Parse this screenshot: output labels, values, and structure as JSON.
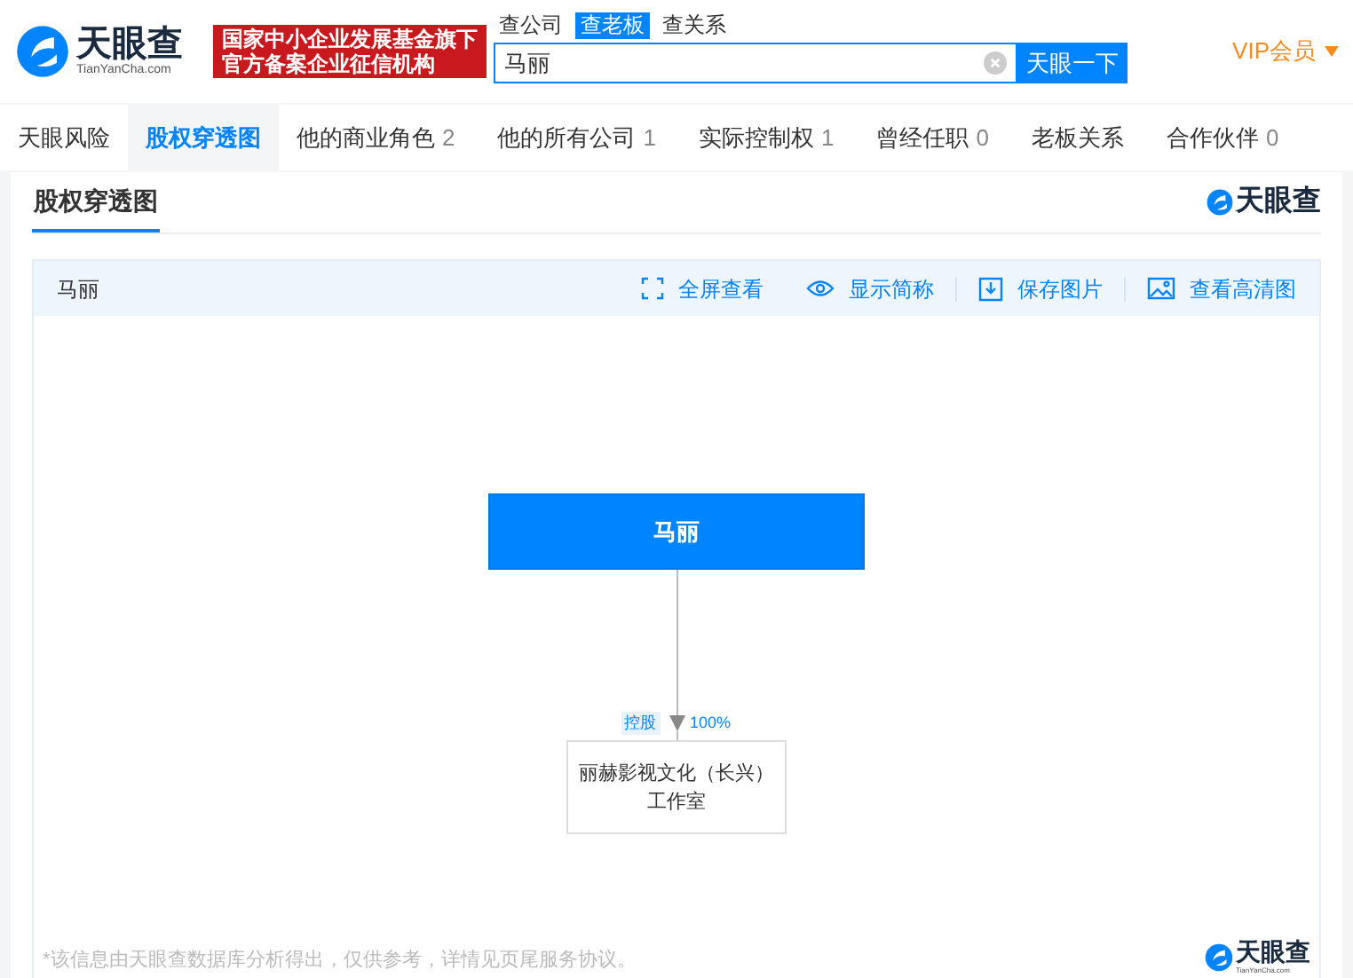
{
  "header": {
    "logo_text": "天眼查",
    "logo_subtext": "TianYanCha.com",
    "banner_lines": [
      "国家中小企业发展基金旗下",
      "官方备案企业征信机构"
    ],
    "search_tabs": [
      {
        "label": "查公司",
        "selected": false
      },
      {
        "label": "查老板",
        "selected": true
      },
      {
        "label": "查关系",
        "selected": false
      }
    ],
    "search": {
      "value": "马丽",
      "button": "天眼一下"
    },
    "vip": "VIP会员"
  },
  "tabs": [
    {
      "label": "天眼风险",
      "selected": false
    },
    {
      "label": "股权穿透图",
      "selected": true
    },
    {
      "label": "他的商业角色",
      "count": "2",
      "selected": false
    },
    {
      "label": "他的所有公司",
      "count": "1",
      "selected": false
    },
    {
      "label": "实际控制权",
      "count": "1",
      "selected": false
    },
    {
      "label": "曾经任职",
      "count": "0",
      "selected": false
    },
    {
      "label": "老板关系",
      "selected": false
    },
    {
      "label": "合作伙伴",
      "count": "0",
      "selected": false
    }
  ],
  "section": {
    "title": "股权穿透图",
    "logo_text": "天眼查"
  },
  "toolbar": {
    "name": "马丽",
    "actions": [
      {
        "kind": "fullscreen",
        "label": "全屏查看"
      },
      {
        "kind": "eye",
        "label": "显示简称"
      },
      {
        "kind": "download",
        "label": "保存图片"
      },
      {
        "kind": "image",
        "label": "查看高清图"
      }
    ]
  },
  "graph": {
    "root": "马丽",
    "edge_tag": "控股",
    "edge_percent": "100%",
    "child": "丽赫影视文化（长兴）工作室"
  },
  "footer": {
    "note": "*该信息由天眼查数据库分析得出，仅供参考，详情见页尾服务协议。",
    "logo_text": "天眼查",
    "logo_subtext": "TianYanCha.com"
  }
}
